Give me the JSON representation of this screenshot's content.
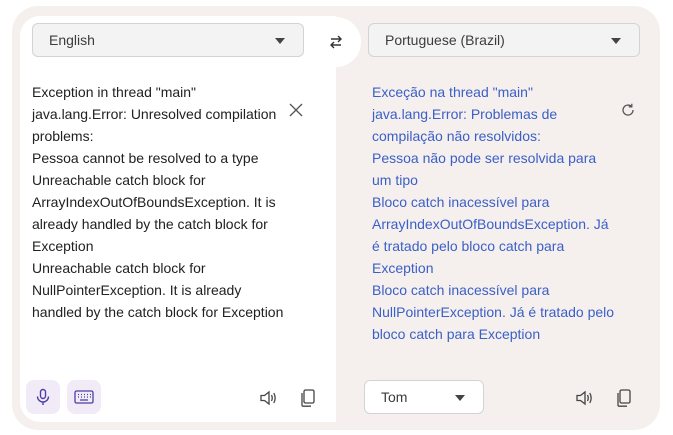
{
  "source": {
    "language": "English",
    "text": "Exception in thread \"main\"\njava.lang.Error: Unresolved compilation\nproblems:\nPessoa cannot be resolved to a type\nUnreachable catch block for\nArrayIndexOutOfBoundsException. It is\nalready handled by the catch block for\nException\nUnreachable catch block for\nNullPointerException. It is already\nhandled by the catch block for Exception",
    "icons": {
      "clear": "close-icon",
      "mic": "microphone-icon",
      "keyboard": "keyboard-icon",
      "speaker": "speaker-icon",
      "copy": "copy-icon"
    }
  },
  "target": {
    "language": "Portuguese (Brazil)",
    "text": "Exceção na thread \"main\"\njava.lang.Error: Problemas de\ncompilação não resolvidos:\nPessoa não pode ser resolvida para\num tipo\nBloco catch inacessível para\nArrayIndexOutOfBoundsException. Já\né tratado pelo bloco catch para\nException\nBloco catch inacessível para\nNullPointerException. Já é tratado pelo\nbloco catch para Exception",
    "tone_label": "Tom",
    "icons": {
      "refresh": "refresh-icon",
      "speaker": "speaker-icon",
      "copy": "copy-icon"
    }
  },
  "swap": {
    "icon": "swap-arrows-icon"
  },
  "colors": {
    "translated_text": "#3b5fc8",
    "panel_bg": "#f5f0ed",
    "accent_pill": "#f1ebf7"
  }
}
